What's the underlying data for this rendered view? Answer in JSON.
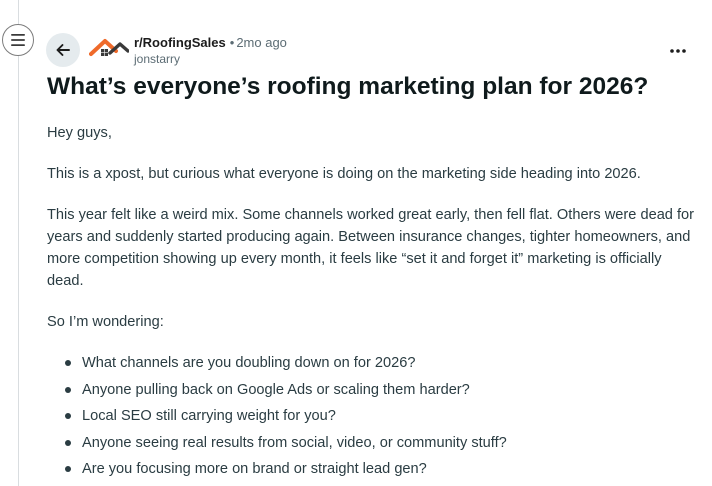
{
  "post": {
    "subreddit": "r/RoofingSales",
    "separator": "•",
    "time_ago": "2mo ago",
    "author": "jonstarry",
    "title": "What’s everyone’s roofing marketing plan for 2026?",
    "paragraphs": [
      "Hey guys,",
      "This is a xpost, but curious what everyone is doing on the marketing side heading into 2026.",
      "This year felt like a weird mix. Some channels worked great early, then fell flat. Others were dead for years and suddenly started producing again. Between insurance changes, tighter homeowners, and more competition showing up every month, it feels like “set it and forget it” marketing is officially dead.",
      "So I’m wondering:"
    ],
    "bullets": [
      "What channels are you doubling down on for 2026?",
      "Anyone pulling back on Google Ads or scaling them harder?",
      "Local SEO still carrying weight for you?",
      "Anyone seeing real results from social, video, or community stuff?",
      "Are you focusing more on brand or straight lead gen?"
    ]
  },
  "icons": {
    "menu": "hamburger-menu-icon",
    "back": "arrow-left-icon",
    "logo": "roofing-house-logo-icon",
    "more": "more-horizontal-icon"
  },
  "colors": {
    "logo_accent": "#ef6a2a",
    "logo_dark": "#3a3a3a",
    "muted_text": "#5c6c74",
    "back_button_bg": "#e5ebee"
  }
}
